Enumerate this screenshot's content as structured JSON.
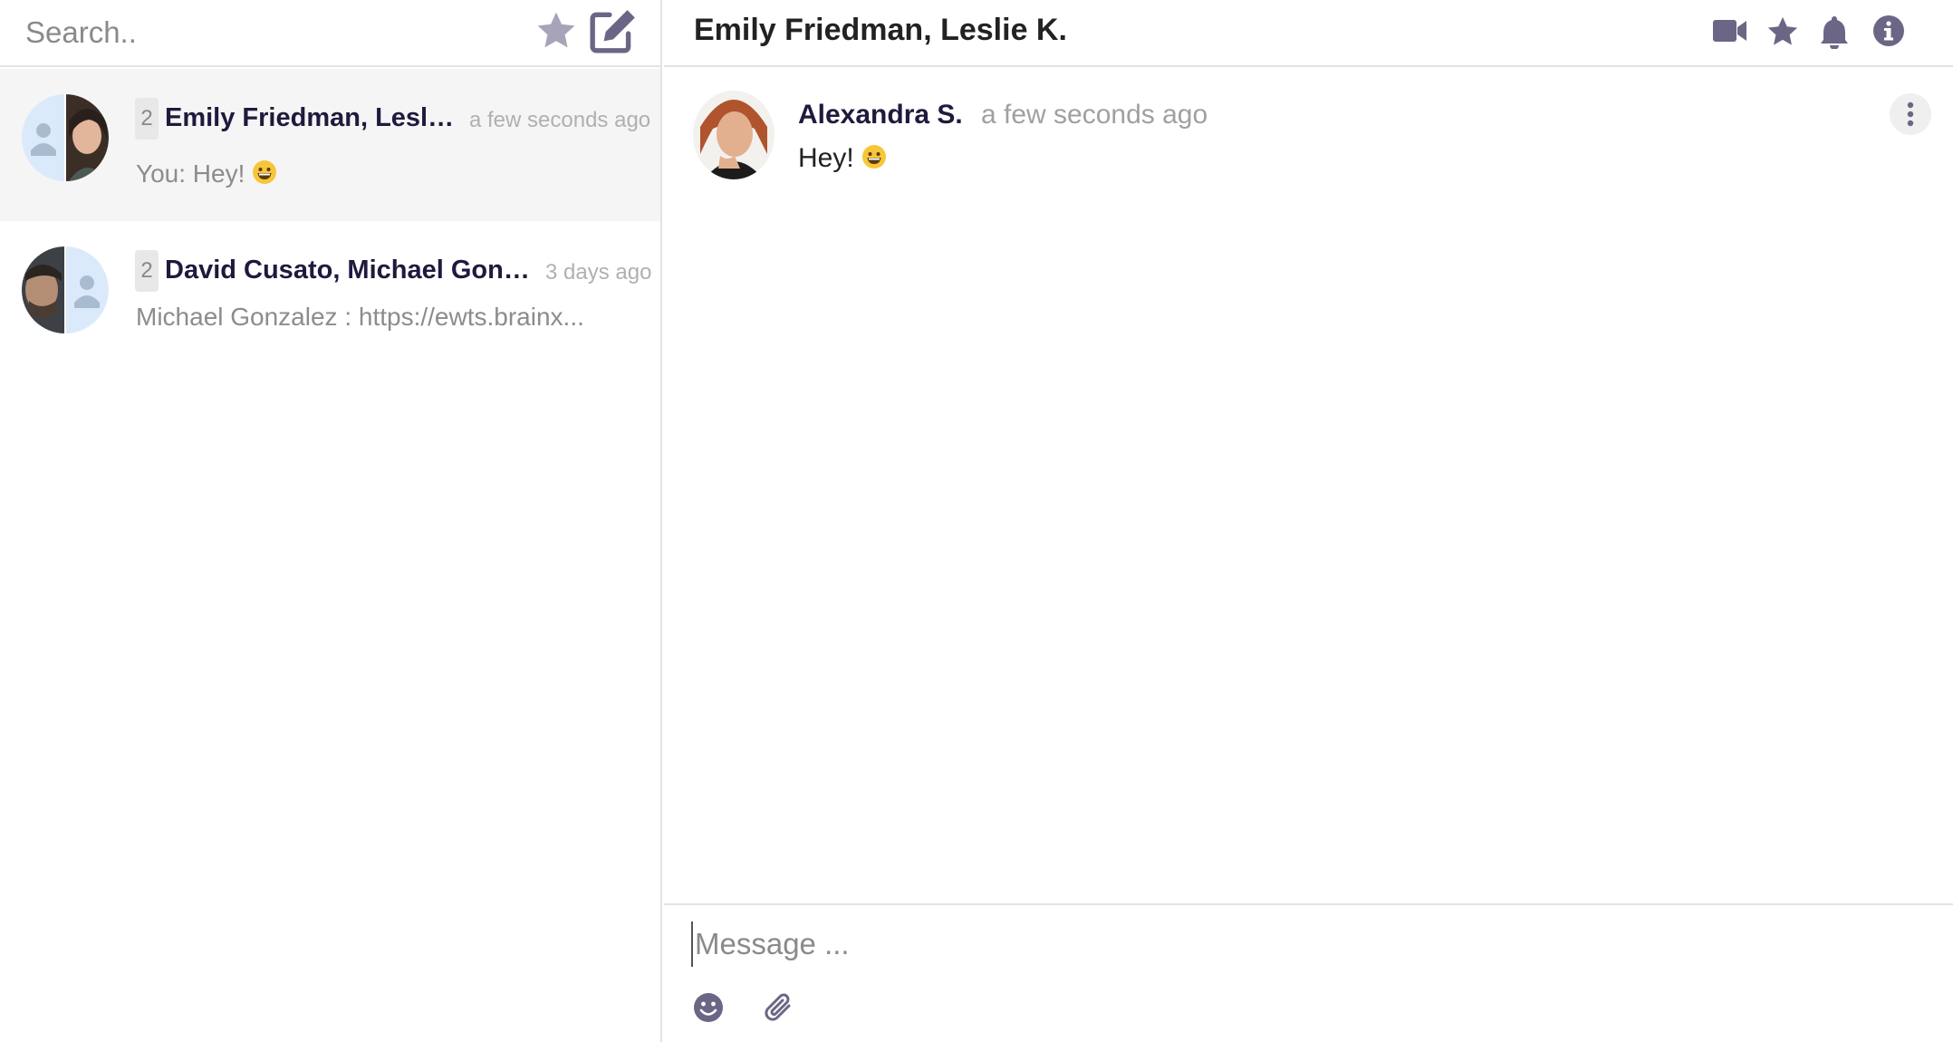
{
  "search": {
    "placeholder": "Search.."
  },
  "conversations": [
    {
      "count": "2",
      "title": "Emily Friedman, Lesli...",
      "time": "a few seconds ago",
      "preview": "You:  Hey!",
      "preview_emoji": "grinning-face-emoji",
      "active": true
    },
    {
      "count": "2",
      "title": "David Cusato, Michael Gonz...",
      "time": "3 days ago",
      "preview": "Michael Gonzalez :  https://ewts.brainx...",
      "active": false
    }
  ],
  "chat": {
    "title": "Emily Friedman, Leslie K.",
    "messages": [
      {
        "author": "Alexandra S.",
        "time": "a few seconds ago",
        "text": "Hey!",
        "emoji": "grinning-face-emoji"
      }
    ]
  },
  "composer": {
    "placeholder": "Message ..."
  },
  "icons": {
    "sidebar_header": [
      "star-icon",
      "compose-icon"
    ],
    "chat_header": [
      "video-camera-icon",
      "star-icon",
      "bell-icon",
      "info-icon"
    ],
    "message": [
      "more-vertical-icon"
    ],
    "composer": [
      "emoji-icon",
      "paperclip-icon"
    ]
  },
  "colors": {
    "icon": "#6b6685",
    "icon_light": "#a7a3b8",
    "title_text": "#1f1a3d",
    "muted_text": "#a0a0a0",
    "active_row": "#f5f5f5",
    "divider": "#e3e3e3"
  }
}
